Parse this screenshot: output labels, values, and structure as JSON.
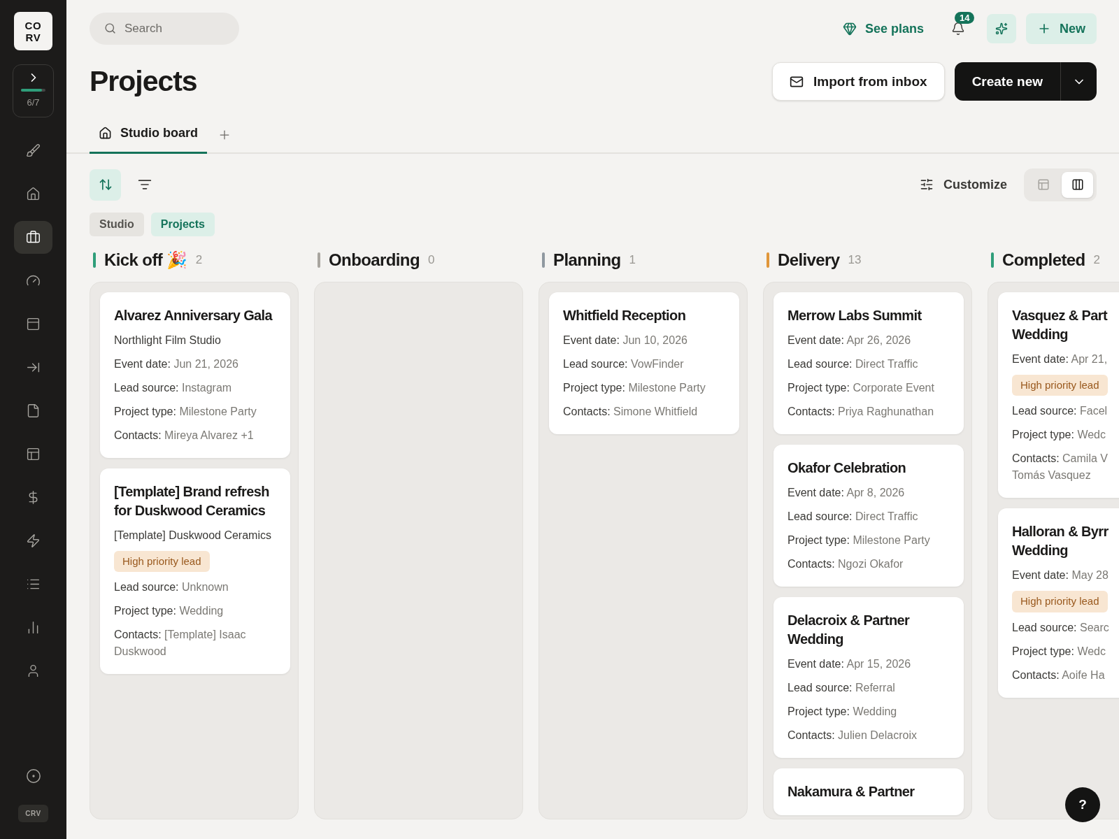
{
  "sidebar": {
    "logo": [
      "CO",
      "RV"
    ],
    "progress": {
      "label": "6/7",
      "level": 0.86
    },
    "items": [
      {
        "selected": false
      },
      {
        "selected": false
      },
      {
        "selected": true
      },
      {
        "selected": false
      },
      {
        "selected": false
      },
      {
        "selected": false
      },
      {
        "selected": false
      },
      {
        "selected": false
      },
      {
        "selected": false
      },
      {
        "selected": false
      },
      {
        "selected": false
      },
      {
        "selected": false
      },
      {
        "selected": false
      }
    ],
    "footer_badge": "CRV"
  },
  "header": {
    "search": {
      "placeholder": "Search"
    },
    "see_plans": "See plans",
    "notifications": "14",
    "new_button": "New"
  },
  "page": {
    "title": "Projects",
    "import_button": "Import from inbox",
    "create_button": "Create new"
  },
  "tabs": [
    {
      "label": "Studio board",
      "selected": true
    }
  ],
  "toolbar": {
    "sort_active": true,
    "customize": "Customize",
    "views": [
      {
        "selected": false
      },
      {
        "selected": true
      }
    ]
  },
  "breadcrumbs": [
    {
      "label": "Studio",
      "selected": false
    },
    {
      "label": "Projects",
      "selected": true
    }
  ],
  "columns": [
    {
      "title": "Kick off 🎉",
      "count": "2",
      "color": "#2f9e7a",
      "cards": [
        {
          "title": "Alvarez Anniversary Gala",
          "rows": [
            {
              "kind": "subtitle",
              "text": "Northlight Film Studio"
            },
            {
              "kind": "field",
              "label": "Event date:",
              "value": "Jun 21, 2026"
            },
            {
              "kind": "field",
              "label": "Lead source:",
              "value": "Instagram"
            },
            {
              "kind": "field",
              "label": "Project type:",
              "value": "Milestone Party"
            },
            {
              "kind": "field",
              "label": "Contacts:",
              "value": "Mireya Alvarez +1"
            }
          ]
        },
        {
          "title": "[Template] Brand refresh for Duskwood Ceramics",
          "rows": [
            {
              "kind": "subtitle",
              "text": "[Template] Duskwood Ceramics"
            },
            {
              "kind": "badge",
              "text": "High priority lead"
            },
            {
              "kind": "field",
              "label": "Lead source:",
              "value": "Unknown"
            },
            {
              "kind": "field",
              "label": "Project type:",
              "value": "Wedding"
            },
            {
              "kind": "field",
              "label": "Contacts:",
              "value": "[Template] Isaac Duskwood"
            }
          ]
        }
      ]
    },
    {
      "title": "Onboarding",
      "count": "0",
      "color": "#a8a59f"
    },
    {
      "title": "Planning",
      "count": "1",
      "color": "#8f98a0",
      "cards": [
        {
          "title": "Whitfield Reception",
          "rows": [
            {
              "kind": "field",
              "label": "Event date:",
              "value": "Jun 10, 2026"
            },
            {
              "kind": "field",
              "label": "Lead source:",
              "value": "VowFinder"
            },
            {
              "kind": "field",
              "label": "Project type:",
              "value": "Milestone Party"
            },
            {
              "kind": "field",
              "label": "Contacts:",
              "value": "Simone Whitfield"
            }
          ]
        }
      ]
    },
    {
      "title": "Delivery",
      "count": "13",
      "color": "#e0963a",
      "cards": [
        {
          "title": "Merrow Labs Summit",
          "rows": [
            {
              "kind": "field",
              "label": "Event date:",
              "value": "Apr 26, 2026"
            },
            {
              "kind": "field",
              "label": "Lead source:",
              "value": "Direct Traffic"
            },
            {
              "kind": "field",
              "label": "Project type:",
              "value": "Corporate Event"
            },
            {
              "kind": "field",
              "label": "Contacts:",
              "value": "Priya Raghunathan"
            }
          ]
        },
        {
          "title": "Okafor Celebration",
          "rows": [
            {
              "kind": "field",
              "label": "Event date:",
              "value": "Apr 8, 2026"
            },
            {
              "kind": "field",
              "label": "Lead source:",
              "value": "Direct Traffic"
            },
            {
              "kind": "field",
              "label": "Project type:",
              "value": "Milestone Party"
            },
            {
              "kind": "field",
              "label": "Contacts:",
              "value": "Ngozi Okafor"
            }
          ]
        },
        {
          "title": "Delacroix & Partner Wedding",
          "rows": [
            {
              "kind": "field",
              "label": "Event date:",
              "value": "Apr 15, 2026"
            },
            {
              "kind": "field",
              "label": "Lead source:",
              "value": "Referral"
            },
            {
              "kind": "field",
              "label": "Project type:",
              "value": "Wedding"
            },
            {
              "kind": "field",
              "label": "Contacts:",
              "value": "Julien Delacroix"
            }
          ]
        },
        {
          "title": "Nakamura & Partner"
        }
      ]
    },
    {
      "title": "Completed",
      "count": "2",
      "color": "#2f9e7a",
      "cards": [
        {
          "title": "Vasquez & Part\nWedding",
          "rows": [
            {
              "kind": "field",
              "label": "Event date:",
              "value": "Apr 21,"
            },
            {
              "kind": "badge",
              "text": "High priority lead"
            },
            {
              "kind": "field",
              "label": "Lead source:",
              "value": "Facel"
            },
            {
              "kind": "field",
              "label": "Project type:",
              "value": "Wedc"
            },
            {
              "kind": "field",
              "label": "Contacts:",
              "value": "Camila V\nTomás Vasquez"
            }
          ]
        },
        {
          "title": "Halloran & Byrr\nWedding",
          "rows": [
            {
              "kind": "field",
              "label": "Event date:",
              "value": "May 28"
            },
            {
              "kind": "badge",
              "text": "High priority lead"
            },
            {
              "kind": "field",
              "label": "Lead source:",
              "value": "Searc"
            },
            {
              "kind": "field",
              "label": "Project type:",
              "value": "Wedc"
            },
            {
              "kind": "field",
              "label": "Contacts:",
              "value": "Aoife Ha"
            }
          ]
        }
      ]
    }
  ],
  "help_button": "?"
}
